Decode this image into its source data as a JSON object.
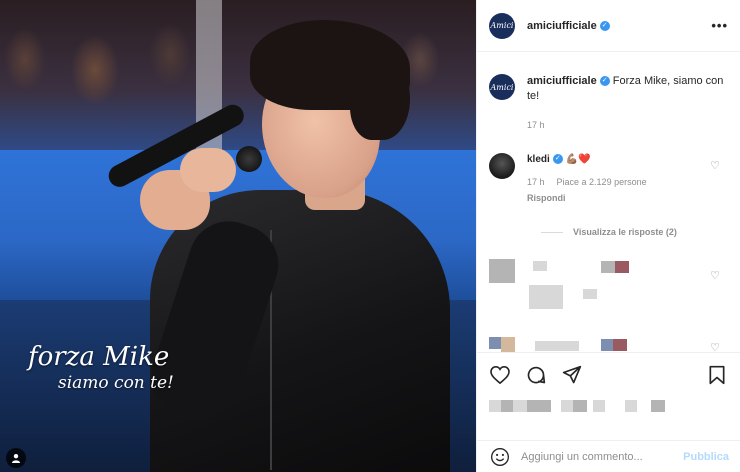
{
  "post": {
    "username": "amiciufficiale",
    "avatar_text": "Amici",
    "more_label": "•••",
    "caption_text": "Forza Mike, siamo con te!",
    "caption_time": "17 h",
    "image_overlay": {
      "line1": "forza Mike",
      "line2": "siamo con te!"
    }
  },
  "comments": [
    {
      "username": "kledi",
      "text": "💪🏽❤️",
      "time": "17 h",
      "likes": "Piace a 2.129 persone",
      "reply_label": "Rispondi",
      "view_replies": "Visualizza le risposte (2)"
    }
  ],
  "actions": {
    "like_icon": "heart-icon",
    "comment_icon": "comment-icon",
    "share_icon": "send-icon",
    "save_icon": "bookmark-icon"
  },
  "add_comment": {
    "placeholder": "Aggiungi un commento...",
    "publish_label": "Pubblica"
  },
  "colors": {
    "verified": "#3897f0",
    "publish": "#b3dbff",
    "heart": "#ed4956"
  }
}
